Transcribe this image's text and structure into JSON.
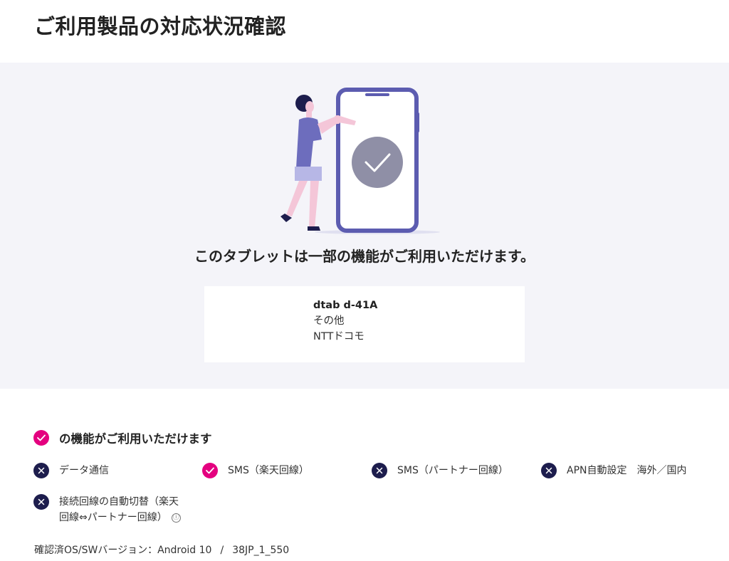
{
  "page": {
    "title": "ご利用製品の対応状況確認"
  },
  "result": {
    "message": "このタブレットは一部の機能がご利用いただけます。",
    "illustration_icon": "person-with-phone-check-illustration"
  },
  "device": {
    "model": "dtab d-41A",
    "category": "その他",
    "carrier": "NTTドコモ"
  },
  "features": {
    "heading": "の機能がご利用いただけます",
    "items": [
      {
        "label": "データ通信",
        "status": "unavailable",
        "icon": "cross-icon"
      },
      {
        "label": "SMS（楽天回線）",
        "status": "available",
        "icon": "check-icon"
      },
      {
        "label": "SMS（パートナー回線）",
        "status": "unavailable",
        "icon": "cross-icon"
      },
      {
        "label": "APN自動設定　海外／国内",
        "status": "unavailable",
        "icon": "cross-icon"
      },
      {
        "label_line1": "接続回線の自動切替（楽天",
        "label_line2": "回線⇔パートナー回線）",
        "status": "unavailable",
        "icon": "cross-icon",
        "info_icon": "ⓘ"
      }
    ]
  },
  "version": {
    "label": "確認済OS/SWバージョン：Android 10",
    "separator": "/",
    "build": "38JP_1_550"
  },
  "colors": {
    "accent": "#e4007f",
    "unavailable": "#1d1d4d",
    "panel_bg": "#f4f4f9",
    "phone": "#5c5cb0"
  }
}
